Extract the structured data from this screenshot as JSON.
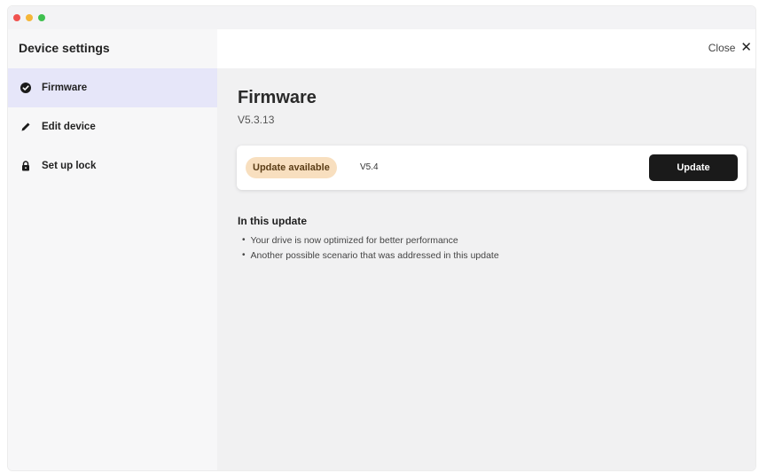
{
  "window": {
    "traffic_lights": [
      {
        "name": "close",
        "color": "#f0524f"
      },
      {
        "name": "minimize",
        "color": "#f5b638"
      },
      {
        "name": "zoom",
        "color": "#3fc04f"
      }
    ]
  },
  "header": {
    "title": "Device settings",
    "close_label": "Close",
    "close_icon": "close-icon"
  },
  "sidebar": {
    "items": [
      {
        "label": "Firmware",
        "icon": "check-circle-icon",
        "active": true
      },
      {
        "label": "Edit device",
        "icon": "pencil-icon",
        "active": false
      },
      {
        "label": "Set up lock",
        "icon": "lock-icon",
        "active": false
      }
    ]
  },
  "main": {
    "title": "Firmware",
    "current_version": "V5.3.13",
    "update_card": {
      "badge": "Update available",
      "new_version": "V5.4",
      "button_label": "Update"
    },
    "notes": {
      "heading": "In this update",
      "items": [
        "Your drive is now optimized for better performance",
        "Another possible scenario that was addressed in this update"
      ]
    }
  },
  "colors": {
    "accent_active_bg": "#e6e6f9",
    "badge_bg": "#f8dfbf",
    "primary_button": "#1a1a1a"
  }
}
